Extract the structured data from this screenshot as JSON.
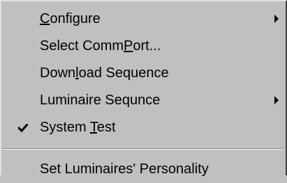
{
  "menu": {
    "items": [
      {
        "pre": "",
        "acc": "C",
        "post": "onfigure",
        "submenu": true,
        "checked": false
      },
      {
        "pre": "Select Comm",
        "acc": "P",
        "post": "ort...",
        "submenu": false,
        "checked": false
      },
      {
        "pre": "Down",
        "acc": "l",
        "post": "oad Sequence",
        "submenu": false,
        "checked": false
      },
      {
        "pre": "Luminaire Sequnce",
        "acc": "",
        "post": "",
        "submenu": true,
        "checked": false
      },
      {
        "pre": "System ",
        "acc": "T",
        "post": "est",
        "submenu": false,
        "checked": true
      },
      {
        "pre": "Set Luminaires' Personality",
        "acc": "",
        "post": "",
        "submenu": false,
        "checked": false
      }
    ],
    "check_icon": "checkmark-icon",
    "submenu_icon": "chevron-right-icon"
  }
}
